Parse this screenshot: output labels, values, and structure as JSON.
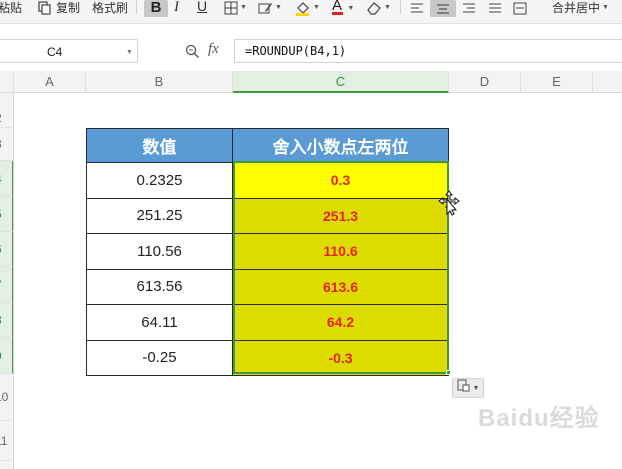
{
  "ribbon": {
    "paste_label": "粘贴",
    "copy_label": "复制",
    "format_painter_label": "格式刷",
    "bold_label": "B",
    "italic_label": "I",
    "underline_label": "U",
    "font_color_label": "A",
    "font_color": "#e02020",
    "merge_center_label": "合并居中"
  },
  "formula_bar": {
    "cell_ref": "C4",
    "fx_label": "fx",
    "formula": "=ROUNDUP(B4,1)"
  },
  "columns": [
    "A",
    "B",
    "C",
    "D",
    "E"
  ],
  "selected_column": "C",
  "rows": [
    {
      "label": "2",
      "selected": false
    },
    {
      "label": "3",
      "selected": false
    },
    {
      "label": "4",
      "selected": true
    },
    {
      "label": "5",
      "selected": true
    },
    {
      "label": "6",
      "selected": true
    },
    {
      "label": "7",
      "selected": true
    },
    {
      "label": "8",
      "selected": true
    },
    {
      "label": "9",
      "selected": true
    },
    {
      "label": "10",
      "selected": false
    },
    {
      "label": "11",
      "selected": false
    }
  ],
  "table": {
    "headers": [
      "数值",
      "舍入小数点左两位"
    ],
    "rows": [
      {
        "value": "0.2325",
        "result": "0.3"
      },
      {
        "value": "251.25",
        "result": "251.3"
      },
      {
        "value": "110.56",
        "result": "110.6"
      },
      {
        "value": "613.56",
        "result": "613.6"
      },
      {
        "value": "64.11",
        "result": "64.2"
      },
      {
        "value": "-0.25",
        "result": "-0.3"
      }
    ]
  },
  "colors": {
    "header_fill": "#5b9bd5",
    "result_fill": "#dcdc00",
    "active_cell_fill": "#ffff00",
    "result_text": "#e8231f",
    "selection": "#3e9a3e"
  },
  "watermark": "Baidu经验"
}
